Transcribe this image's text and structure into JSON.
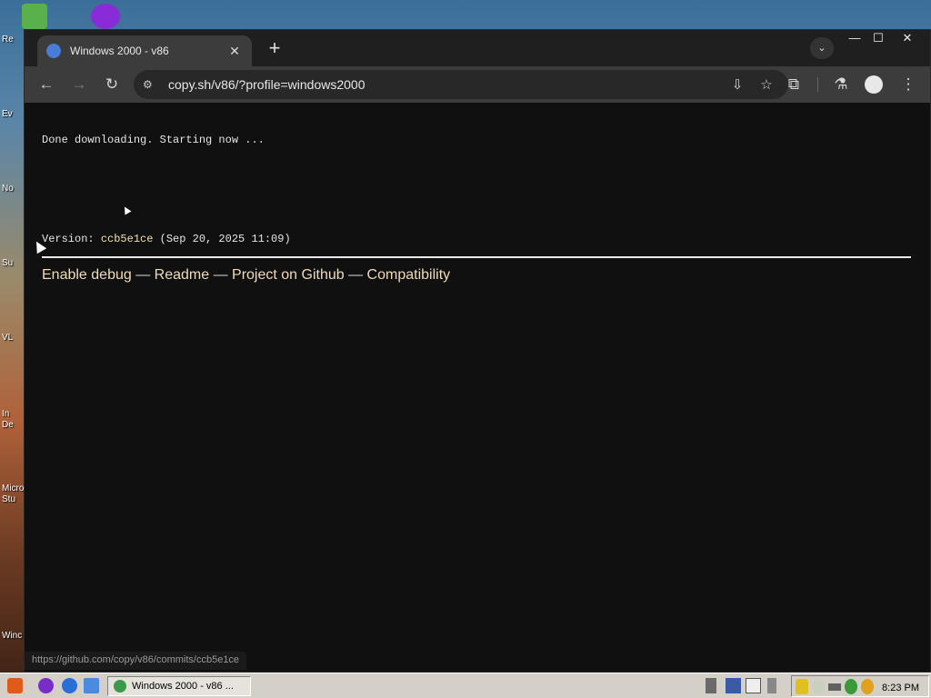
{
  "window": {
    "tab_title": "Windows 2000 - v86",
    "tab_close": "✕",
    "new_tab": "+",
    "tab_search": "⌄",
    "minimize": "—",
    "maximize": "☐",
    "close": "✕"
  },
  "toolbar": {
    "back": "←",
    "forward": "→",
    "reload": "↻",
    "url": "copy.sh/v86/?profile=windows2000",
    "install_icon": "⇩",
    "bookmark_icon": "☆",
    "extensions_icon": "⧉",
    "labs_icon": "⚗",
    "menu_icon": "⋮"
  },
  "page": {
    "status_message": "Done downloading. Starting now ...",
    "version_prefix": "Version: ",
    "version_hash": "ccb5e1ce",
    "version_date": " (Sep 20, 2025 11:09)",
    "links": [
      "Enable debug",
      "Readme",
      "Project on Github",
      "Compatibility"
    ],
    "separator": " — "
  },
  "status_bar": {
    "hover_url": "https://github.com/copy/v86/commits/ccb5e1ce"
  },
  "desktop": {
    "labels": [
      "Re",
      "Ev",
      "No",
      "Su",
      "VL",
      "In",
      "De",
      "Micro",
      "Stu",
      "Winc"
    ]
  },
  "taskbar": {
    "task_button": "Windows 2000 - v86 ...",
    "clock": "8:23 PM"
  }
}
